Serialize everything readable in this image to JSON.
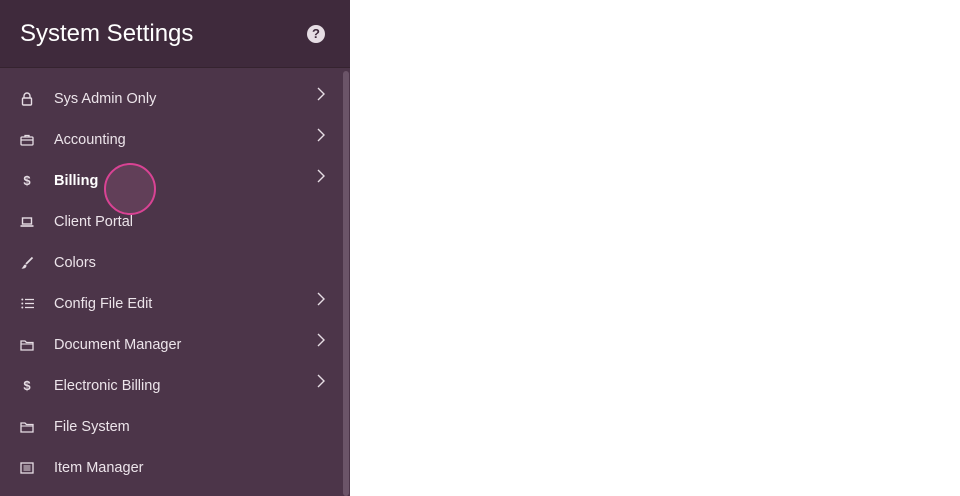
{
  "sidebar": {
    "title": "System Settings",
    "help_icon": "help-icon",
    "help_glyph": "?",
    "items": [
      {
        "label": "Sys Admin Only",
        "icon": "lock-icon",
        "has_submenu": true
      },
      {
        "label": "Accounting",
        "icon": "briefcase-icon",
        "has_submenu": true
      },
      {
        "label": "Billing",
        "icon": "dollar-icon",
        "glyph": "$",
        "has_submenu": true,
        "active": true
      },
      {
        "label": "Client Portal",
        "icon": "laptop-icon",
        "has_submenu": false
      },
      {
        "label": "Colors",
        "icon": "brush-icon",
        "has_submenu": false
      },
      {
        "label": "Config File Edit",
        "icon": "list-icon",
        "has_submenu": true
      },
      {
        "label": "Document Manager",
        "icon": "folder-icon",
        "has_submenu": true
      },
      {
        "label": "Electronic Billing",
        "icon": "dollar-icon",
        "glyph": "$",
        "has_submenu": true
      },
      {
        "label": "File System",
        "icon": "folder-icon",
        "has_submenu": false
      },
      {
        "label": "Item Manager",
        "icon": "list-box-icon",
        "has_submenu": false
      }
    ]
  },
  "colors": {
    "sidebar_bg": "#4c3549",
    "header_bg": "#3f2a3c",
    "text": "#ece4ea",
    "cursor_ring": "#d94394"
  }
}
